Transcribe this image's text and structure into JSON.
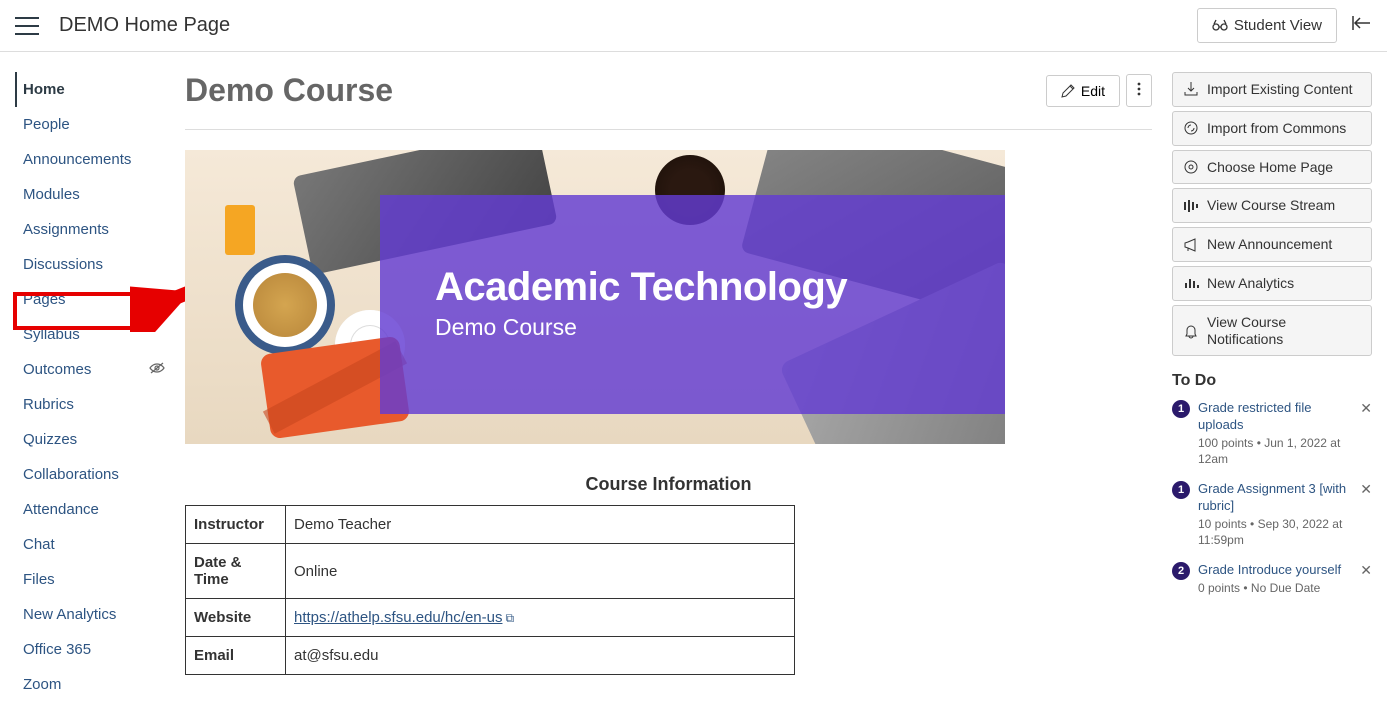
{
  "header": {
    "breadcrumb": "DEMO Home Page",
    "student_view": "Student View"
  },
  "nav": {
    "items": [
      {
        "label": "Home",
        "active": true
      },
      {
        "label": "People"
      },
      {
        "label": "Announcements"
      },
      {
        "label": "Modules"
      },
      {
        "label": "Assignments",
        "highlighted": true
      },
      {
        "label": "Discussions"
      },
      {
        "label": "Pages"
      },
      {
        "label": "Syllabus"
      },
      {
        "label": "Outcomes",
        "hidden": true
      },
      {
        "label": "Rubrics"
      },
      {
        "label": "Quizzes"
      },
      {
        "label": "Collaborations"
      },
      {
        "label": "Attendance"
      },
      {
        "label": "Chat"
      },
      {
        "label": "Files"
      },
      {
        "label": "New Analytics"
      },
      {
        "label": "Office 365"
      },
      {
        "label": "Zoom"
      }
    ]
  },
  "content": {
    "title": "Demo Course",
    "edit_label": "Edit",
    "banner": {
      "title": "Academic Technology",
      "subtitle": "Demo Course"
    },
    "info_heading": "Course Information",
    "info_rows": [
      {
        "label": "Instructor",
        "value": "Demo Teacher"
      },
      {
        "label": "Date & Time",
        "value": "Online"
      },
      {
        "label": "Website",
        "value": "https://athelp.sfsu.edu/hc/en-us",
        "link": true
      },
      {
        "label": "Email",
        "value": "at@sfsu.edu"
      }
    ]
  },
  "actions": [
    {
      "label": "Import Existing Content",
      "icon": "import"
    },
    {
      "label": "Import from Commons",
      "icon": "commons"
    },
    {
      "label": "Choose Home Page",
      "icon": "home"
    },
    {
      "label": "View Course Stream",
      "icon": "stream"
    },
    {
      "label": "New Announcement",
      "icon": "announce"
    },
    {
      "label": "New Analytics",
      "icon": "analytics"
    },
    {
      "label": "View Course Notifications",
      "icon": "bell"
    }
  ],
  "todo": {
    "heading": "To Do",
    "items": [
      {
        "badge": "1",
        "title": "Grade restricted file uploads",
        "meta": "100 points • Jun 1, 2022 at 12am"
      },
      {
        "badge": "1",
        "title": "Grade Assignment 3 [with rubric]",
        "meta": "10 points • Sep 30, 2022 at 11:59pm"
      },
      {
        "badge": "2",
        "title": "Grade Introduce yourself",
        "meta": "0 points • No Due Date"
      }
    ]
  }
}
